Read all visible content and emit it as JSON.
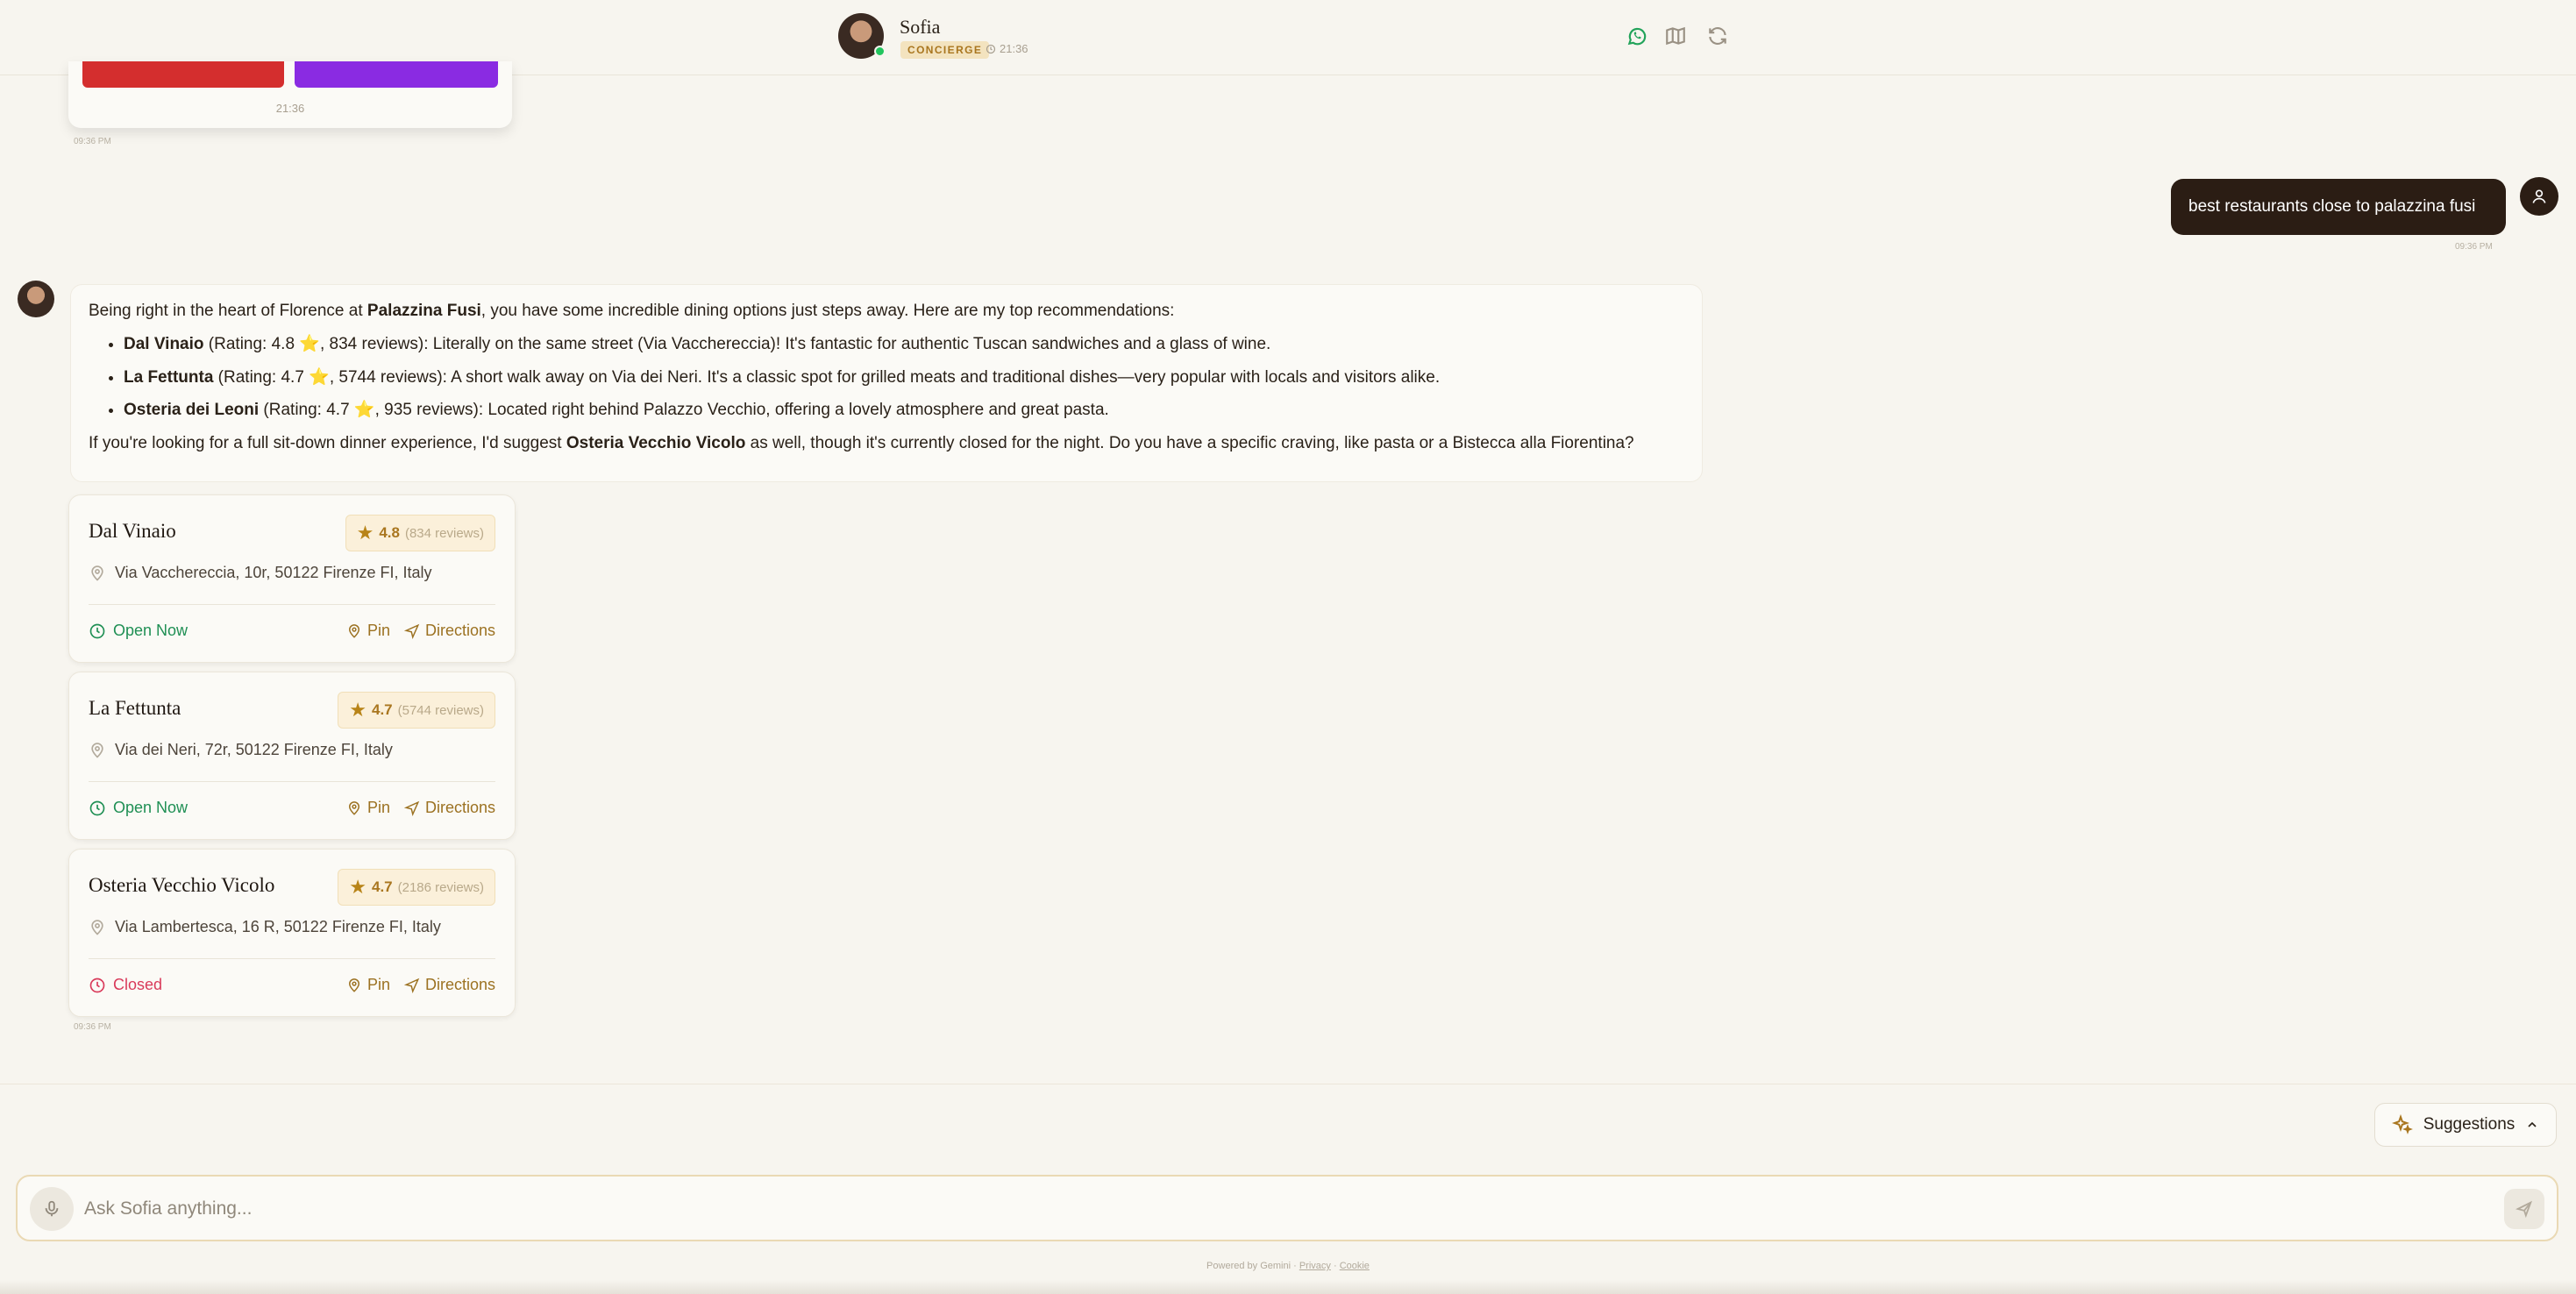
{
  "header": {
    "agent_name": "Sofia",
    "agent_role": "CONCIERGE",
    "time": "21:36",
    "icons": [
      "whatsapp-icon",
      "map-icon",
      "refresh-icon"
    ]
  },
  "previous_card": {
    "time": "21:36",
    "stamp": "09:36 PM"
  },
  "user_message": {
    "text": "best restaurants close to palazzina fusi",
    "stamp": "09:36 PM"
  },
  "bot_message": {
    "intro_before": "Being right in the heart of Florence at ",
    "intro_bold": "Palazzina Fusi",
    "intro_after": ", you have some incredible dining options just steps away. Here are my top recommendations:",
    "items": [
      {
        "name": "Dal Vinaio",
        "text": " (Rating: 4.8 ⭐, 834 reviews): Literally on the same street (Via Vacchereccia)! It's fantastic for authentic Tuscan sandwiches and a glass of wine."
      },
      {
        "name": "La Fettunta",
        "text": " (Rating: 4.7 ⭐, 5744 reviews): A short walk away on Via dei Neri. It's a classic spot for grilled meats and traditional dishes—very popular with locals and visitors alike."
      },
      {
        "name": "Osteria dei Leoni",
        "text": " (Rating: 4.7 ⭐, 935 reviews): Located right behind Palazzo Vecchio, offering a lovely atmosphere and great pasta."
      }
    ],
    "outro_before": "If you're looking for a full sit-down dinner experience, I'd suggest ",
    "outro_bold": "Osteria Vecchio Vicolo",
    "outro_after": " as well, though it's currently closed for the night. Do you have a specific craving, like pasta or a Bistecca alla Fiorentina?"
  },
  "cards": [
    {
      "name": "Dal Vinaio",
      "score": "4.8",
      "reviews": "(834 reviews)",
      "address": "Via Vacchereccia, 10r, 50122 Firenze FI, Italy",
      "status": "Open Now",
      "pin": "Pin",
      "directions": "Directions"
    },
    {
      "name": "La Fettunta",
      "score": "4.7",
      "reviews": "(5744 reviews)",
      "address": "Via dei Neri, 72r, 50122 Firenze FI, Italy",
      "status": "Open Now",
      "pin": "Pin",
      "directions": "Directions"
    },
    {
      "name": "Osteria Vecchio Vicolo",
      "score": "4.7",
      "reviews": "(2186 reviews)",
      "address": "Via Lambertesca, 16 R, 50122 Firenze FI, Italy",
      "status": "Closed",
      "pin": "Pin",
      "directions": "Directions"
    }
  ],
  "cards_stamp": "09:36 PM",
  "footer": {
    "suggestions_label": "Suggestions",
    "input_placeholder": "Ask Sofia anything...",
    "powered_by": "Powered by Gemini ·",
    "privacy": "Privacy",
    "separator": "·",
    "cookie": "Cookie"
  },
  "colors": {
    "background": "#f7f5ef",
    "user_bubble": "#2b1d14",
    "accent_gold": "#a9761f",
    "open_green": "#1f8f54",
    "closed_red": "#d93a5a"
  }
}
